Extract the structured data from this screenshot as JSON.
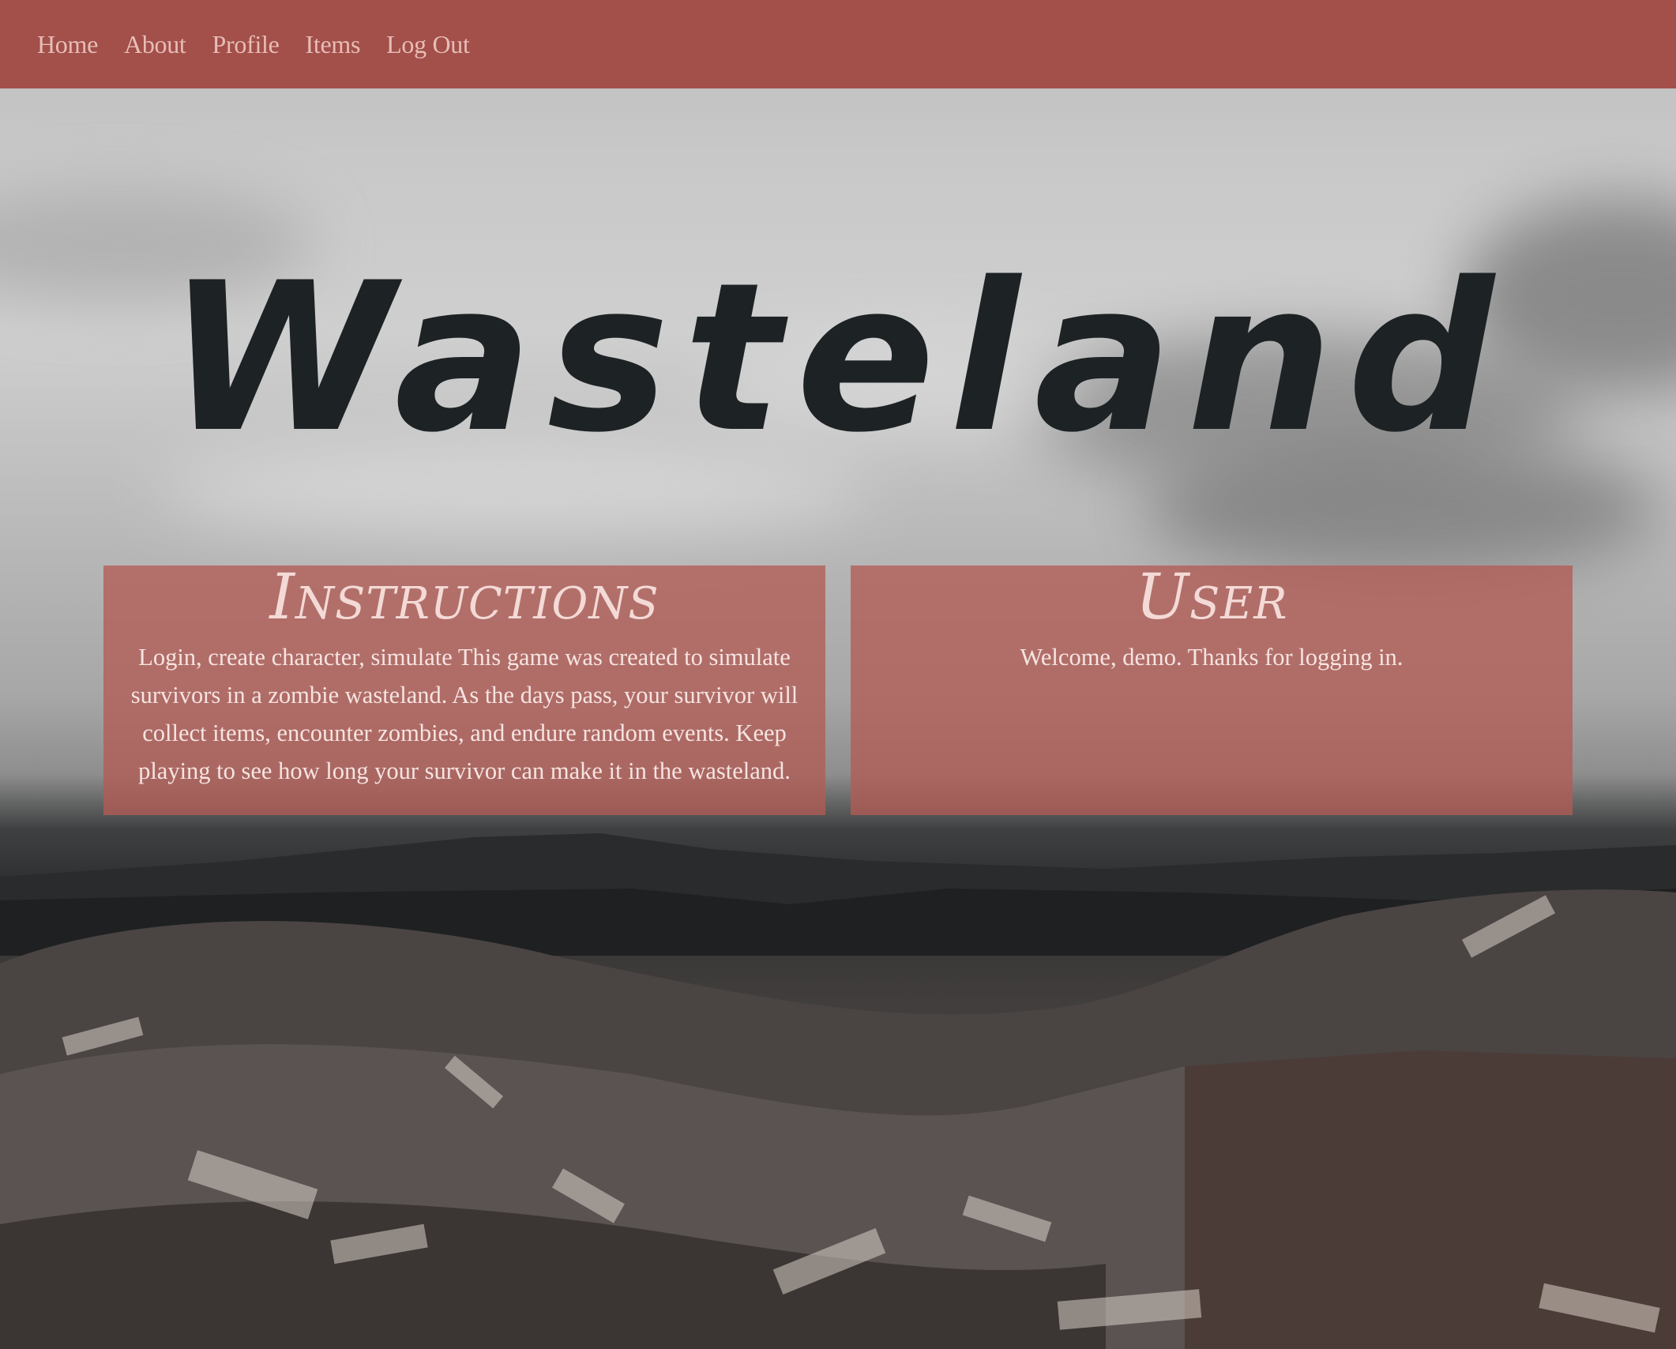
{
  "nav": {
    "items": [
      {
        "label": "Home"
      },
      {
        "label": "About"
      },
      {
        "label": "Profile"
      },
      {
        "label": "Items"
      },
      {
        "label": "Log Out"
      }
    ]
  },
  "hero": {
    "title": "Wasteland"
  },
  "instructions": {
    "title": "Instructions",
    "body": "Login, create character, simulate This game was created to simulate survivors in a zombie wasteland. As the days pass, your survivor will collect items, encounter zombies, and endure random events. Keep playing to see how long your survivor can make it in the wasteland."
  },
  "user": {
    "title": "User",
    "body": "Welcome, demo. Thanks for logging in."
  },
  "colors": {
    "navbar": "#a34f4a",
    "nav_text": "#e7bdb7",
    "panel": "#b25c56",
    "title_text": "#1d2224",
    "panel_text": "#f6e4e1"
  }
}
